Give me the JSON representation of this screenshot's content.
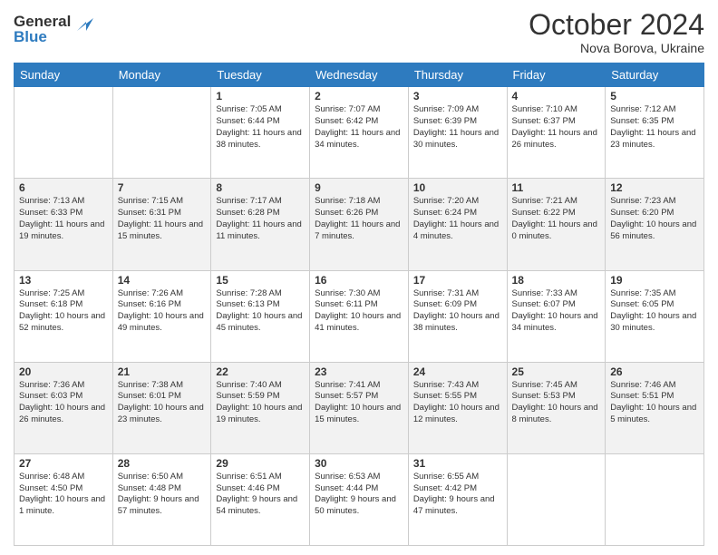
{
  "header": {
    "logo_line1": "General",
    "logo_line2": "Blue",
    "month": "October 2024",
    "location": "Nova Borova, Ukraine"
  },
  "weekdays": [
    "Sunday",
    "Monday",
    "Tuesday",
    "Wednesday",
    "Thursday",
    "Friday",
    "Saturday"
  ],
  "weeks": [
    [
      {
        "day": "",
        "info": ""
      },
      {
        "day": "",
        "info": ""
      },
      {
        "day": "1",
        "info": "Sunrise: 7:05 AM\nSunset: 6:44 PM\nDaylight: 11 hours and 38 minutes."
      },
      {
        "day": "2",
        "info": "Sunrise: 7:07 AM\nSunset: 6:42 PM\nDaylight: 11 hours and 34 minutes."
      },
      {
        "day": "3",
        "info": "Sunrise: 7:09 AM\nSunset: 6:39 PM\nDaylight: 11 hours and 30 minutes."
      },
      {
        "day": "4",
        "info": "Sunrise: 7:10 AM\nSunset: 6:37 PM\nDaylight: 11 hours and 26 minutes."
      },
      {
        "day": "5",
        "info": "Sunrise: 7:12 AM\nSunset: 6:35 PM\nDaylight: 11 hours and 23 minutes."
      }
    ],
    [
      {
        "day": "6",
        "info": "Sunrise: 7:13 AM\nSunset: 6:33 PM\nDaylight: 11 hours and 19 minutes."
      },
      {
        "day": "7",
        "info": "Sunrise: 7:15 AM\nSunset: 6:31 PM\nDaylight: 11 hours and 15 minutes."
      },
      {
        "day": "8",
        "info": "Sunrise: 7:17 AM\nSunset: 6:28 PM\nDaylight: 11 hours and 11 minutes."
      },
      {
        "day": "9",
        "info": "Sunrise: 7:18 AM\nSunset: 6:26 PM\nDaylight: 11 hours and 7 minutes."
      },
      {
        "day": "10",
        "info": "Sunrise: 7:20 AM\nSunset: 6:24 PM\nDaylight: 11 hours and 4 minutes."
      },
      {
        "day": "11",
        "info": "Sunrise: 7:21 AM\nSunset: 6:22 PM\nDaylight: 11 hours and 0 minutes."
      },
      {
        "day": "12",
        "info": "Sunrise: 7:23 AM\nSunset: 6:20 PM\nDaylight: 10 hours and 56 minutes."
      }
    ],
    [
      {
        "day": "13",
        "info": "Sunrise: 7:25 AM\nSunset: 6:18 PM\nDaylight: 10 hours and 52 minutes."
      },
      {
        "day": "14",
        "info": "Sunrise: 7:26 AM\nSunset: 6:16 PM\nDaylight: 10 hours and 49 minutes."
      },
      {
        "day": "15",
        "info": "Sunrise: 7:28 AM\nSunset: 6:13 PM\nDaylight: 10 hours and 45 minutes."
      },
      {
        "day": "16",
        "info": "Sunrise: 7:30 AM\nSunset: 6:11 PM\nDaylight: 10 hours and 41 minutes."
      },
      {
        "day": "17",
        "info": "Sunrise: 7:31 AM\nSunset: 6:09 PM\nDaylight: 10 hours and 38 minutes."
      },
      {
        "day": "18",
        "info": "Sunrise: 7:33 AM\nSunset: 6:07 PM\nDaylight: 10 hours and 34 minutes."
      },
      {
        "day": "19",
        "info": "Sunrise: 7:35 AM\nSunset: 6:05 PM\nDaylight: 10 hours and 30 minutes."
      }
    ],
    [
      {
        "day": "20",
        "info": "Sunrise: 7:36 AM\nSunset: 6:03 PM\nDaylight: 10 hours and 26 minutes."
      },
      {
        "day": "21",
        "info": "Sunrise: 7:38 AM\nSunset: 6:01 PM\nDaylight: 10 hours and 23 minutes."
      },
      {
        "day": "22",
        "info": "Sunrise: 7:40 AM\nSunset: 5:59 PM\nDaylight: 10 hours and 19 minutes."
      },
      {
        "day": "23",
        "info": "Sunrise: 7:41 AM\nSunset: 5:57 PM\nDaylight: 10 hours and 15 minutes."
      },
      {
        "day": "24",
        "info": "Sunrise: 7:43 AM\nSunset: 5:55 PM\nDaylight: 10 hours and 12 minutes."
      },
      {
        "day": "25",
        "info": "Sunrise: 7:45 AM\nSunset: 5:53 PM\nDaylight: 10 hours and 8 minutes."
      },
      {
        "day": "26",
        "info": "Sunrise: 7:46 AM\nSunset: 5:51 PM\nDaylight: 10 hours and 5 minutes."
      }
    ],
    [
      {
        "day": "27",
        "info": "Sunrise: 6:48 AM\nSunset: 4:50 PM\nDaylight: 10 hours and 1 minute."
      },
      {
        "day": "28",
        "info": "Sunrise: 6:50 AM\nSunset: 4:48 PM\nDaylight: 9 hours and 57 minutes."
      },
      {
        "day": "29",
        "info": "Sunrise: 6:51 AM\nSunset: 4:46 PM\nDaylight: 9 hours and 54 minutes."
      },
      {
        "day": "30",
        "info": "Sunrise: 6:53 AM\nSunset: 4:44 PM\nDaylight: 9 hours and 50 minutes."
      },
      {
        "day": "31",
        "info": "Sunrise: 6:55 AM\nSunset: 4:42 PM\nDaylight: 9 hours and 47 minutes."
      },
      {
        "day": "",
        "info": ""
      },
      {
        "day": "",
        "info": ""
      }
    ]
  ]
}
